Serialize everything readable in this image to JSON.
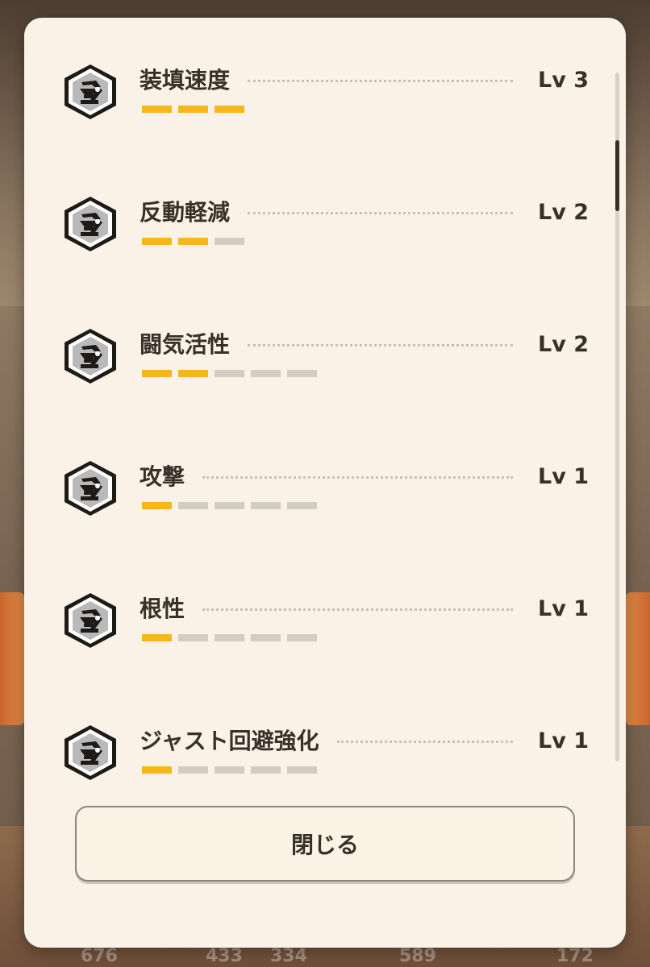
{
  "skills": [
    {
      "name": "装填速度",
      "level": "Lv 3",
      "current": 3,
      "max": 3,
      "icon": "turret-skill-icon"
    },
    {
      "name": "反動軽減",
      "level": "Lv 2",
      "current": 2,
      "max": 3,
      "icon": "turret-skill-icon"
    },
    {
      "name": "闘気活性",
      "level": "Lv 2",
      "current": 2,
      "max": 5,
      "icon": "turret-skill-icon"
    },
    {
      "name": "攻撃",
      "level": "Lv 1",
      "current": 1,
      "max": 5,
      "icon": "turret-skill-icon"
    },
    {
      "name": "根性",
      "level": "Lv 1",
      "current": 1,
      "max": 5,
      "icon": "turret-skill-icon"
    },
    {
      "name": "ジャスト回避強化",
      "level": "Lv 1",
      "current": 1,
      "max": 5,
      "icon": "turret-skill-icon"
    }
  ],
  "close_label": "閉じる",
  "colors": {
    "panel": "#faf2e7",
    "bar_filled": "#f6b61c",
    "bar_empty": "#d3ccc3",
    "text": "#3b2f27"
  },
  "background_stats": [
    "676",
    "433",
    "334",
    "589",
    "172"
  ]
}
